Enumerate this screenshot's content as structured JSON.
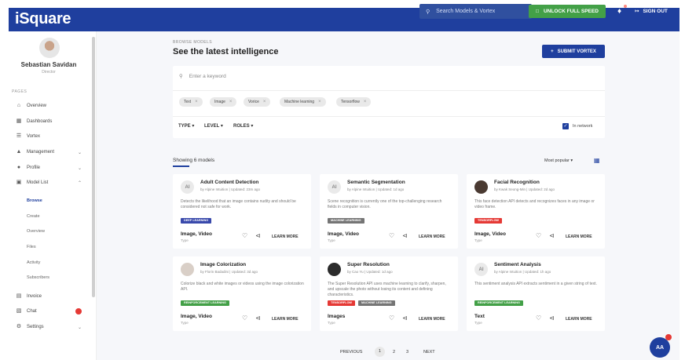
{
  "app": {
    "logo": "iSquare"
  },
  "topbar": {
    "search_placeholder": "Search Models & Vortex",
    "unlock_label": "UNLOCK FULL SPEED",
    "signout_label": "SIGN OUT"
  },
  "user": {
    "name": "Sebastian Savidan",
    "role": "Director"
  },
  "sidebar": {
    "section_label": "PAGES",
    "items": [
      {
        "label": "Overview",
        "icon": "home-icon"
      },
      {
        "label": "Dashboards",
        "icon": "dashboard-icon"
      },
      {
        "label": "Vortex",
        "icon": "list-icon"
      },
      {
        "label": "Management",
        "icon": "chart-icon"
      },
      {
        "label": "Profile",
        "icon": "person-icon"
      },
      {
        "label": "Model List",
        "icon": "folder-icon"
      }
    ],
    "subitems": [
      "Browse",
      "Create",
      "Overview",
      "Files",
      "Activity",
      "Subscribers"
    ],
    "bottom_items": [
      {
        "label": "Invoice",
        "icon": "invoice-icon"
      },
      {
        "label": "Chat",
        "icon": "chat-icon"
      },
      {
        "label": "Settings",
        "icon": "gear-icon"
      }
    ]
  },
  "page": {
    "crumb": "BROWSE MODELS",
    "title": "See the latest intelligence",
    "submit_label": "SUBMIT VORTEX"
  },
  "filters": {
    "keyword_placeholder": "Enter a keyword",
    "chips": [
      "Text",
      "Image",
      "Vorice",
      "Machine learning",
      "Tensorflow"
    ],
    "dropdowns": [
      "TYPE",
      "LEVEL",
      "ROLES"
    ],
    "in_network_label": "In network"
  },
  "results": {
    "showing_label": "Showing 6 models",
    "sort_label": "Most popular"
  },
  "cards": [
    {
      "title": "Adult Content Detection",
      "sub": "by Alpine Intuition | Updated: 23m ago",
      "desc": "Detects the likelihood that an image contains nudity and should be considered not safe for work.",
      "tags": [
        {
          "label": "DEEP LEARNING",
          "color": "#3949ab"
        }
      ],
      "type": "Image, Video",
      "type_label": "Type",
      "avatar": "AI"
    },
    {
      "title": "Semantic Segmentation",
      "sub": "by Alpine Intuition | Updated: 1d ago",
      "desc": "Scene recognition is currently one of the top-challenging research fields in computer vision.",
      "tags": [
        {
          "label": "MACHINE LEARNING",
          "color": "#757575"
        }
      ],
      "type": "Image, Video",
      "type_label": "Type",
      "avatar": "AI"
    },
    {
      "title": "Facial Recognition",
      "sub": "by Kwak Seong-Min | Updated: 2d ago",
      "desc": "This face detection API detects and recognizes faces in any image or video frame.",
      "tags": [
        {
          "label": "TENSORFLOW",
          "color": "#e53935"
        }
      ],
      "type": "Image, Video",
      "type_label": "Type",
      "avatar": ""
    },
    {
      "title": "Image Colorization",
      "sub": "by Florin Badadini | Updated: 3d ago",
      "desc": "Colorize black and white images or videos using the image colorization API.",
      "tags": [
        {
          "label": "REINFORCEMENT LEARNING",
          "color": "#43a047"
        }
      ],
      "type": "Image, Video",
      "type_label": "Type",
      "avatar": ""
    },
    {
      "title": "Super Resolution",
      "sub": "by Cao Yu | Updated: 1d ago",
      "desc": "The Super Resolution API uses machine learning to clarify, sharpen, and upscale the photo without losing its content and defining characteristics.",
      "tags": [
        {
          "label": "TENSORFLOW",
          "color": "#e53935"
        },
        {
          "label": "MACHINE LEARNING",
          "color": "#757575"
        }
      ],
      "type": "Images",
      "type_label": "Type",
      "avatar": ""
    },
    {
      "title": "Sentiment Analysis",
      "sub": "by Alpine Intuition | Updated: 1h ago",
      "desc": "This sentiment analysis API extracts sentiment in a given string of text.",
      "tags": [
        {
          "label": "REINFORCEMENT LEARNING",
          "color": "#43a047"
        }
      ],
      "type": "Text",
      "type_label": "Type",
      "avatar": "AI"
    }
  ],
  "card_action": "LEARN MORE",
  "pagination": {
    "prev": "PREVIOUS",
    "pages": [
      "1",
      "2",
      "3"
    ],
    "next": "NEXT"
  },
  "fab": {
    "label": "AA"
  }
}
